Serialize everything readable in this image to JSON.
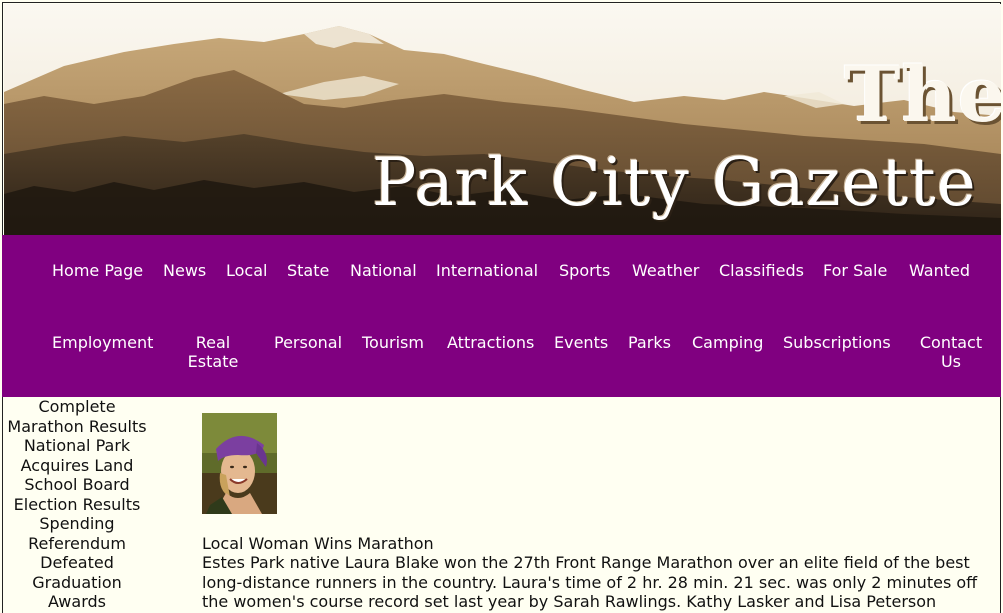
{
  "banner": {
    "title_the": "The",
    "title_main": "Park City Gazette"
  },
  "nav": {
    "row1": [
      "Home Page",
      "News",
      "Local",
      "State",
      "National",
      "International",
      "Sports",
      "Weather",
      "Classifieds",
      "For Sale",
      "Wanted"
    ],
    "row2": [
      "Employment",
      "Real Estate",
      "Personal",
      "Tourism",
      "Attractions",
      "Events",
      "Parks",
      "Camping",
      "Subscriptions",
      "Contact Us"
    ]
  },
  "sidebar": {
    "links": [
      "Complete Marathon Results",
      "National Park Acquires Land",
      "School Board Election Results",
      "Spending Referendum Defeated",
      "Graduation Awards"
    ]
  },
  "article": {
    "photo_icon": "runner-portrait-icon",
    "title": "Local Woman Wins Marathon",
    "body": "Estes Park native Laura Blake won the 27th Front Range Marathon over an elite field of the best long-distance runners in the country. Laura's time of 2 hr. 28 min. 21 sec. was only 2 minutes off the women's course record set last year by Sarah Rawlings. Kathy Lasker and Lisa Peterson"
  },
  "colors": {
    "nav_bg": "#800080",
    "page_bg": "#fffff2",
    "nav_text": "#ffffff"
  }
}
